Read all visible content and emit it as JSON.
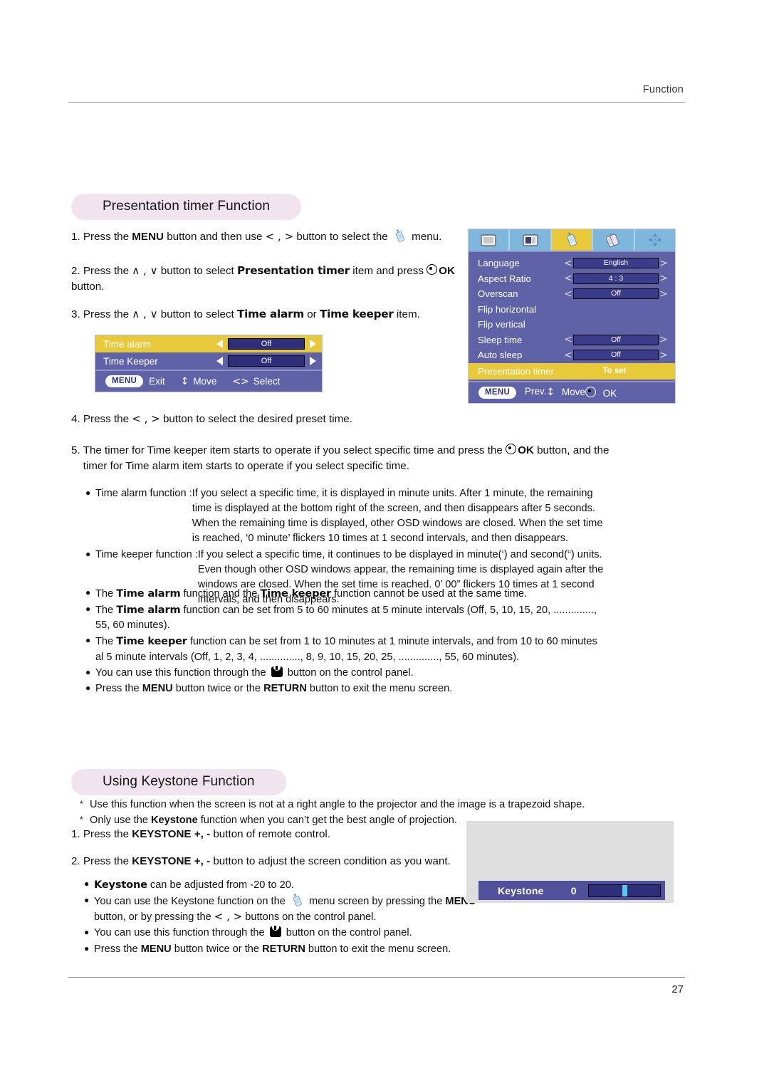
{
  "header": {
    "section": "Function"
  },
  "footer": {
    "page_number": "27"
  },
  "section1": {
    "title": "Presentation timer Function",
    "steps": [
      {
        "num": "1.",
        "pre": "Press the ",
        "b1": "MENU",
        "mid": " button and then use ",
        "arrows": "< , >",
        "post": " button to select the ",
        "icon": "tag-icon",
        "tail": " menu."
      },
      {
        "num": "2.",
        "text_a": "Press the ",
        "ud": "∧ , ∨",
        "text_b": " button to select ",
        "bold": "Presentation timer",
        "text_c": " item and press ",
        "ok": "OK",
        "text_d": " button."
      },
      {
        "num": "3.",
        "text_a": "Press the ",
        "ud": "∧ , ∨",
        "text_b": " button to select ",
        "bold1": "Time alarm",
        "text_c": " or ",
        "bold2": "Time keeper",
        "text_d": " item."
      },
      {
        "num": "4.",
        "text_a": "Press the ",
        "arrows": "< , >",
        "text_b": " button to select the desired preset time."
      },
      {
        "num": "5.",
        "text_a": "The timer for Time keeper item starts to operate if you select specific time and press the ",
        "ok": "OK",
        "text_b": " button, and the timer for Time alarm item starts to operate if you select specific time."
      }
    ],
    "notes": [
      {
        "lead": "Time alarm function : ",
        "rest": "If you select a specific time, it is displayed in minute units. After 1 minute, the remaining time is displayed at the bottom right of the screen, and then disappears after 5 seconds. When the remaining time is displayed, other OSD windows are closed. When the set time is reached, ‘0 minute’ flickers 10 times at 1 second intervals, and then disappears."
      },
      {
        "lead": "Time keeper function : ",
        "rest": "If you select a specific time, it continues to be displayed in minute(‘) and second(“) units. Even though other OSD windows appear, the remaining time is displayed again after the windows are closed. When the set time is reached. 0’ 00” flickers 10 times at 1 second intervals, and then disappears."
      }
    ],
    "bullets": [
      {
        "p1": "The ",
        "b1": "Time alarm",
        "p2": " function and the ",
        "b2": "Time keeper",
        "p3": " function cannot be used at the same time."
      },
      {
        "p1": "The ",
        "b1": "Time alarm",
        "p2": " function can be set from 5 to 60 minutes at 5 minute intervals (Off, 5, 10, 15, 20, .............., 55, 60 minutes)."
      },
      {
        "p1": "The ",
        "b1": "Time keeper",
        "p2": " function can be set from 1 to 10 minutes at 1 minute intervals, and from 10 to 60 minutes al 5 minute intervals (Off, 1, 2, 3, 4, .............., 8, 9, 10, 15, 20, 25, .............., 55, 60 minutes)."
      },
      {
        "p1": "You can use this function through the ",
        "icon": "panel-button-icon",
        "p2": " button on the control panel."
      },
      {
        "p1": "Press the ",
        "b1": "MENU",
        "p2": " button twice or the ",
        "b2": "RETURN",
        "p3": " button to exit the menu screen."
      }
    ]
  },
  "osd_popup": {
    "rows": [
      {
        "label": "Time alarm",
        "value": "Off",
        "selected": true
      },
      {
        "label": "Time Keeper",
        "value": "Off",
        "selected": false
      }
    ],
    "bar": {
      "chip": "MENU",
      "exit": "Exit",
      "move": "Move",
      "select": "Select",
      "move_glyph": "↕",
      "select_glyph": "<>"
    }
  },
  "osd_main": {
    "tabs": [
      {
        "name": "picture-tab",
        "active": false
      },
      {
        "name": "screen-tab",
        "active": false
      },
      {
        "name": "option-tab",
        "active": true
      },
      {
        "name": "signal-tab",
        "active": false
      },
      {
        "name": "network-tab",
        "active": false
      }
    ],
    "items": [
      {
        "label": "Language",
        "value": "English",
        "has_value": true,
        "highlight": false
      },
      {
        "label": "Aspect Ratio",
        "value": "4 : 3",
        "has_value": true,
        "highlight": false
      },
      {
        "label": "Overscan",
        "value": "Off",
        "has_value": true,
        "highlight": false
      },
      {
        "label": "Flip horizontal",
        "value": "",
        "has_value": false,
        "highlight": false
      },
      {
        "label": "Flip vertical",
        "value": "",
        "has_value": false,
        "highlight": false
      },
      {
        "label": "Sleep time",
        "value": "Off",
        "has_value": true,
        "highlight": false
      },
      {
        "label": "Auto sleep",
        "value": "Off",
        "has_value": true,
        "highlight": false
      },
      {
        "label": "Presentation timer",
        "value": "To set",
        "has_value": false,
        "highlight": true
      }
    ],
    "bar": {
      "chip": "MENU",
      "prev": "Prev.",
      "move": "Move",
      "ok": "OK",
      "move_glyph": "↕"
    }
  },
  "section2": {
    "title": "Using Keystone Function",
    "asterisks": [
      {
        "p1": "Use this function when the screen is not at a right angle to the projector and the image is a trapezoid shape."
      },
      {
        "p1": "Only use the ",
        "b1": "Keystone",
        "p2": " function when you can’t get the best angle of projection."
      }
    ],
    "steps": [
      {
        "num": "1.",
        "p1": "Press the ",
        "b1": "KEYSTONE +, -",
        "p2": " button of remote control."
      },
      {
        "num": "2.",
        "p1": "Press the ",
        "b1": "KEYSTONE +, -",
        "p2": " button to adjust the screen condition as you want."
      }
    ],
    "bullets": [
      {
        "b1": "Keystone",
        "p2": " can be adjusted from -20 to 20."
      },
      {
        "p1": "You can use the Keystone function on the ",
        "icon": "tag-icon",
        "p2": " menu screen by pressing the ",
        "b1": "MENU",
        "p3": " button, or by pressing the ",
        "arrows": "< , >",
        "p4": " buttons on the control panel."
      },
      {
        "p1": "You can use this function through the ",
        "icon": "panel-button-icon",
        "p2": " button on the control panel."
      },
      {
        "p1": "Press the ",
        "b1": "MENU",
        "p2": " button twice or the ",
        "b2": "RETURN",
        "p3": " button to exit the menu screen."
      }
    ]
  },
  "keystone_osd": {
    "label": "Keystone",
    "value": "0"
  },
  "colors": {
    "pill": "#f2e4ee",
    "osd_bg": "#5f62a6",
    "osd_highlight": "#e8c93a",
    "osd_value_box": "#3b3b8c",
    "tab_bg": "#7fb6dc",
    "keystone_panel": "#dedede",
    "keystone_bar": "#51519b",
    "keystone_thumb": "#56c8f0"
  }
}
